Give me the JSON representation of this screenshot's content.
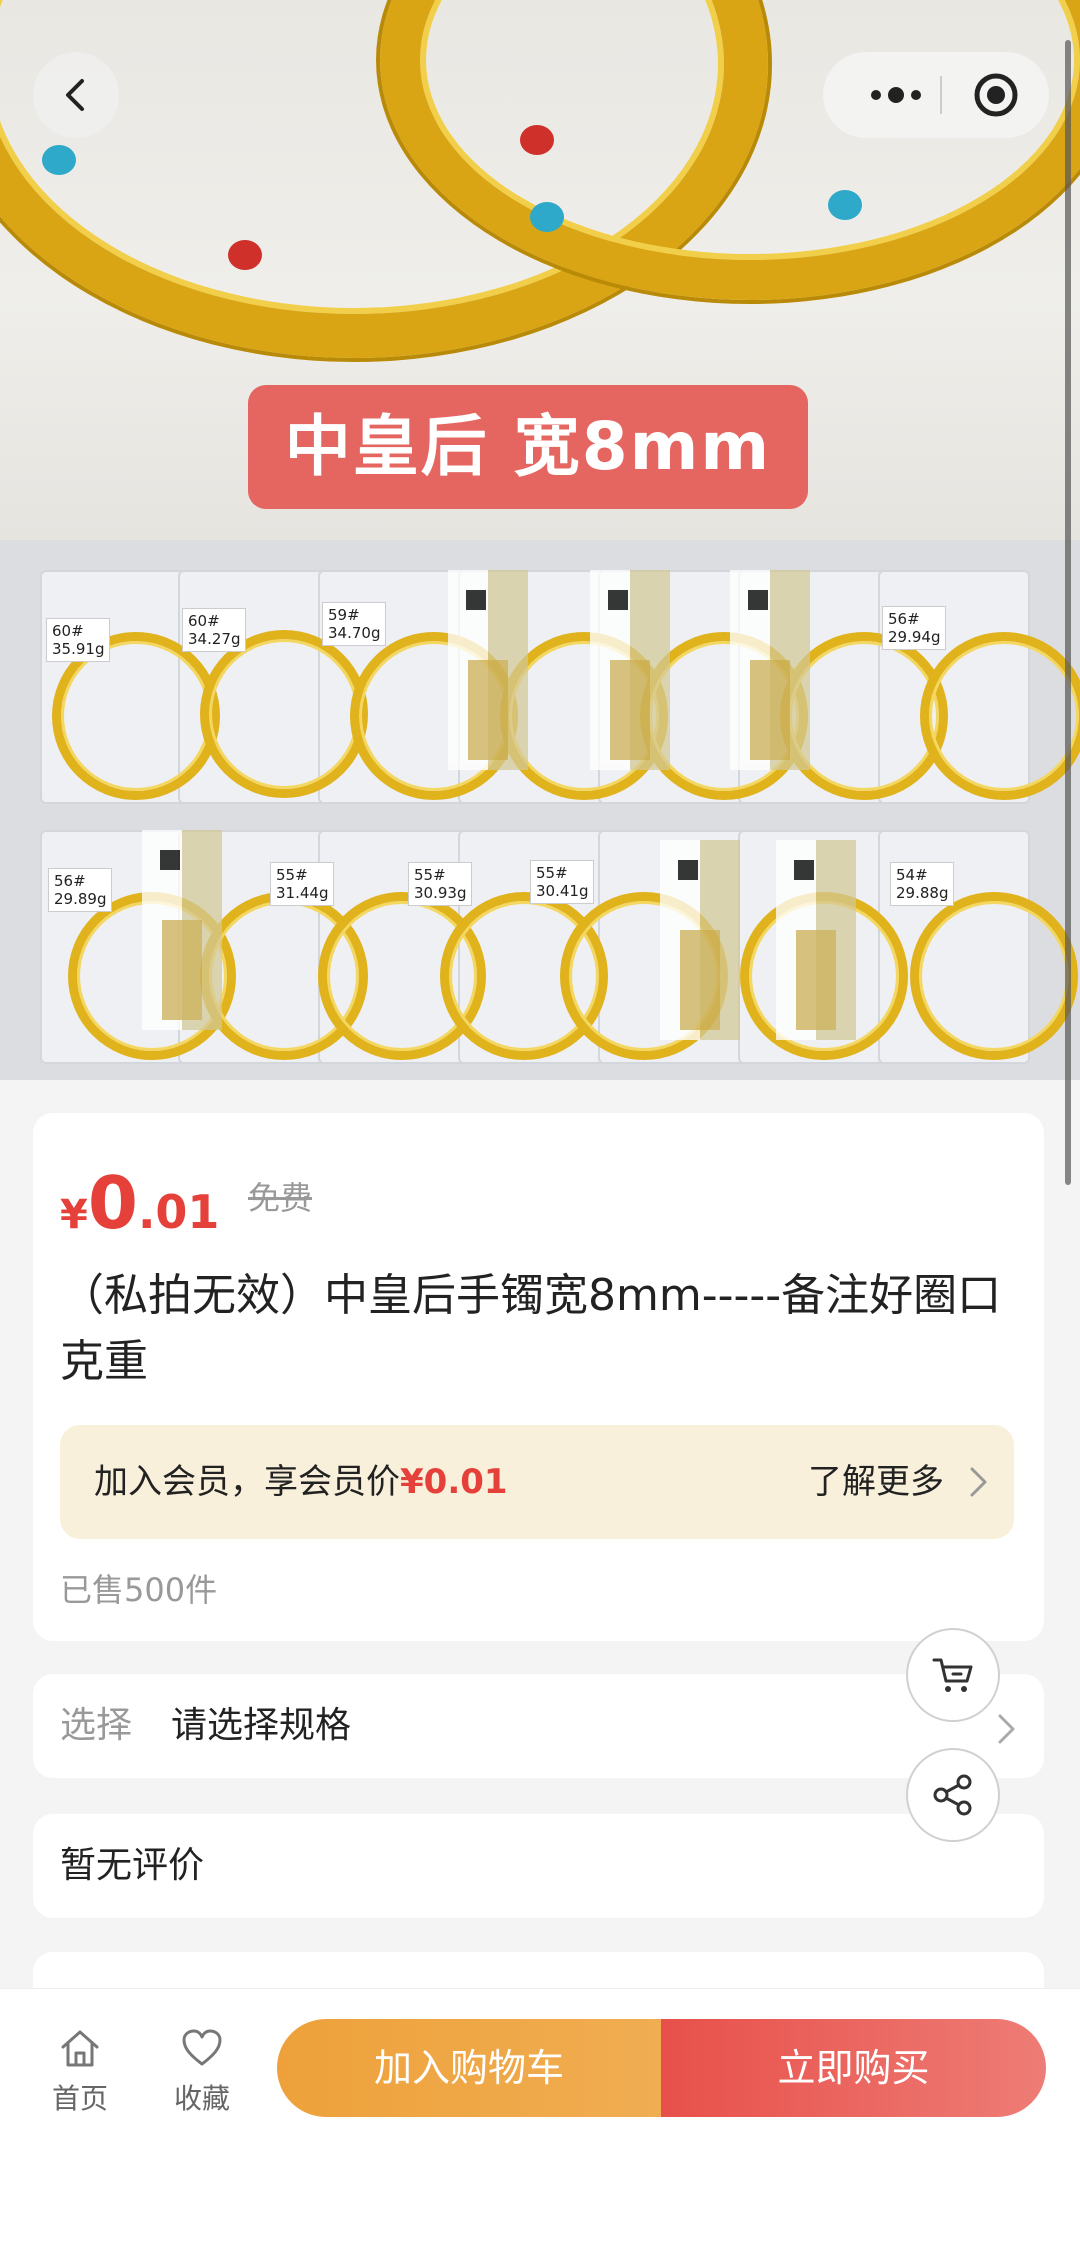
{
  "product_image": {
    "badge_text": "中皇后 宽8mm",
    "tags": [
      "60#\n35.91g",
      "60#\n34.27g",
      "59#\n34.70g",
      "56#\n29.94g",
      "56#\n29.89g",
      "55#\n31.44g",
      "55#\n30.93g",
      "55#\n30.41g",
      "54#\n29.88g"
    ]
  },
  "nav": {
    "back_icon": "chevron-left-icon",
    "more_icon": "more-dots-icon",
    "close_icon": "target-icon"
  },
  "info": {
    "currency": "¥",
    "price_int": "0",
    "price_dec": ".01",
    "original_price": "免费",
    "title": "（私拍无效）中皇后手镯宽8mm-----备注好圈口克重",
    "member_text": "加入会员，享会员价",
    "member_price": "¥0.01",
    "more_label": "了解更多",
    "sold": "已售500件"
  },
  "spec": {
    "label": "选择",
    "value": "请选择规格"
  },
  "review": {
    "text": "暂无评价"
  },
  "bottom": {
    "home_label": "首页",
    "fav_label": "收藏",
    "add_cart_label": "加入购物车",
    "buy_label": "立即购买"
  },
  "colors": {
    "price_red": "#e5403a",
    "cart_orange": "#eea13a",
    "buy_red": "#e8504a",
    "member_bg": "#f8f0db"
  }
}
